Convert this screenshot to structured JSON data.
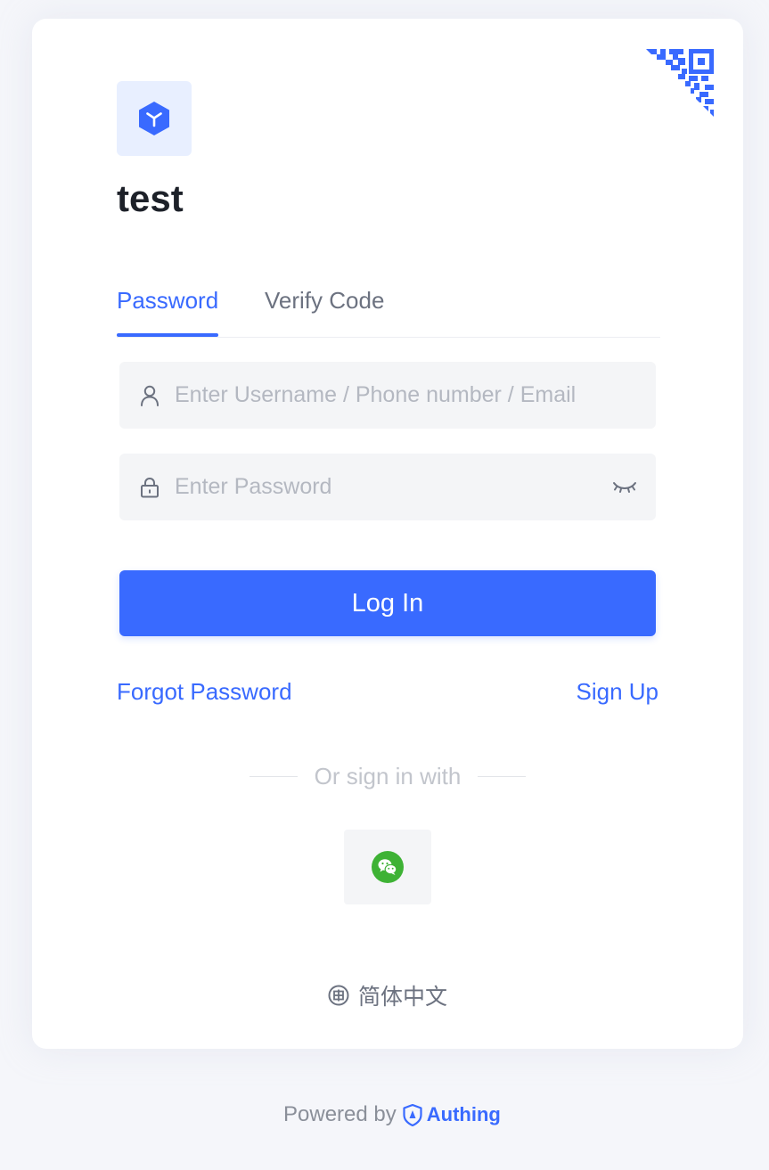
{
  "app": {
    "title": "test"
  },
  "tabs": [
    {
      "label": "Password",
      "active": true
    },
    {
      "label": "Verify Code",
      "active": false
    }
  ],
  "form": {
    "username_placeholder": "Enter Username / Phone number / Email",
    "username_value": "",
    "password_placeholder": "Enter Password",
    "password_value": "",
    "login_label": "Log In"
  },
  "links": {
    "forgot_password": "Forgot Password",
    "sign_up": "Sign Up"
  },
  "social": {
    "divider_text": "Or sign in with",
    "providers": [
      {
        "name": "wechat-icon"
      }
    ]
  },
  "language": {
    "label": "简体中文"
  },
  "footer": {
    "powered_by": "Powered by",
    "brand": "Authing"
  },
  "colors": {
    "accent": "#396aff",
    "wechat": "#3eb235",
    "background": "#f5f6fa"
  },
  "icons": {
    "qr": "qr-code-corner-icon",
    "logo": "cube-logo-icon",
    "user": "user-icon",
    "lock": "lock-icon",
    "eye": "eye-closed-icon",
    "globe": "globe-icon",
    "shield": "authing-shield-icon"
  }
}
